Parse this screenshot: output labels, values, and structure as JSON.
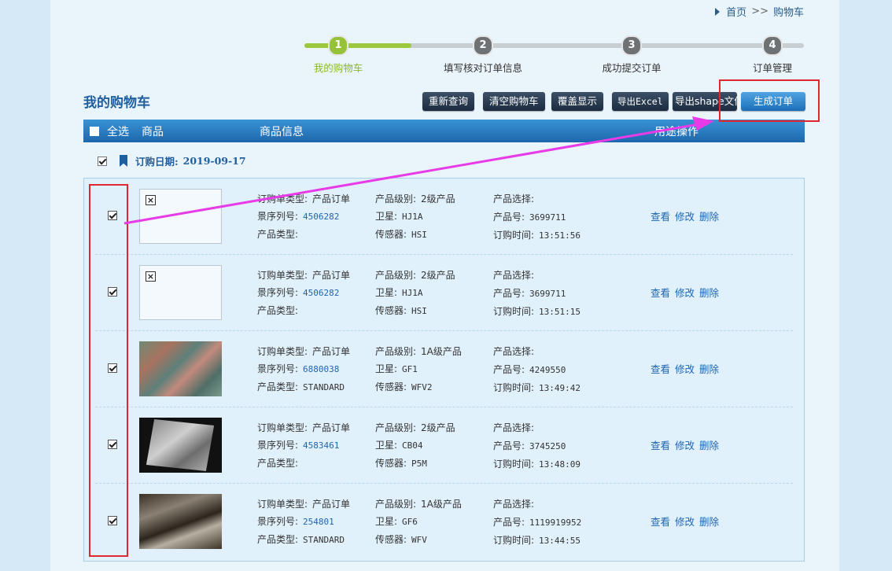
{
  "breadcrumb": {
    "home": "首页",
    "separator": ">>",
    "current": "购物车"
  },
  "steps": [
    {
      "num": "1",
      "label": "我的购物车",
      "active": true
    },
    {
      "num": "2",
      "label": "填写核对订单信息",
      "active": false
    },
    {
      "num": "3",
      "label": "成功提交订单",
      "active": false
    },
    {
      "num": "4",
      "label": "订单管理",
      "active": false
    }
  ],
  "page_title": "我的购物车",
  "toolbar": {
    "requery": "重新查询",
    "clear_cart": "清空购物车",
    "overlay_display": "覆盖显示",
    "export_excel": "导出Excel",
    "export_shape": "导出shape文件",
    "generate_order": "生成订单"
  },
  "table_header": {
    "select_all": "全选",
    "product": "商品",
    "product_info": "商品信息",
    "usage": "用途",
    "operation": "操作"
  },
  "order_date": {
    "label": "订购日期:",
    "value": "2019-09-17"
  },
  "item_labels": {
    "order_type": "订购单类型:",
    "scene_serial": "景序列号:",
    "product_type": "产品类型:",
    "product_level": "产品级别:",
    "satellite": "卫星:",
    "sensor": "传感器:",
    "product_select": "产品选择:",
    "product_no": "产品号:",
    "order_time": "订购时间:"
  },
  "actions": {
    "view": "查看",
    "modify": "修改",
    "delete": "删除"
  },
  "items": [
    {
      "order_type": "产品订单",
      "scene_serial": "4506282",
      "product_type": "",
      "product_level": "2级产品",
      "satellite": "HJ1A",
      "sensor": "HSI",
      "product_select": "",
      "product_no": "3699711",
      "order_time": "13:51:56",
      "thumb": "blank",
      "checked": true
    },
    {
      "order_type": "产品订单",
      "scene_serial": "4506282",
      "product_type": "",
      "product_level": "2级产品",
      "satellite": "HJ1A",
      "sensor": "HSI",
      "product_select": "",
      "product_no": "3699711",
      "order_time": "13:51:15",
      "thumb": "blank",
      "checked": true
    },
    {
      "order_type": "产品订单",
      "scene_serial": "6880038",
      "product_type": "STANDARD",
      "product_level": "1A级产品",
      "satellite": "GF1",
      "sensor": "WFV2",
      "product_select": "",
      "product_no": "4249550",
      "order_time": "13:49:42",
      "thumb": "image",
      "checked": true
    },
    {
      "order_type": "产品订单",
      "scene_serial": "4583461",
      "product_type": "",
      "product_level": "2级产品",
      "satellite": "CB04",
      "sensor": "P5M",
      "product_select": "",
      "product_no": "3745250",
      "order_time": "13:48:09",
      "thumb": "image",
      "checked": true
    },
    {
      "order_type": "产品订单",
      "scene_serial": "254801",
      "product_type": "STANDARD",
      "product_level": "1A级产品",
      "satellite": "GF6",
      "sensor": "WFV",
      "product_select": "",
      "product_no": "1119919952",
      "order_time": "13:44:55",
      "thumb": "image",
      "checked": true
    }
  ],
  "colors": {
    "annotation_red": "#e0262f",
    "annotation_arrow": "#e83be8",
    "header_blue": "#2a7bc4",
    "step_active": "#96c23a"
  }
}
